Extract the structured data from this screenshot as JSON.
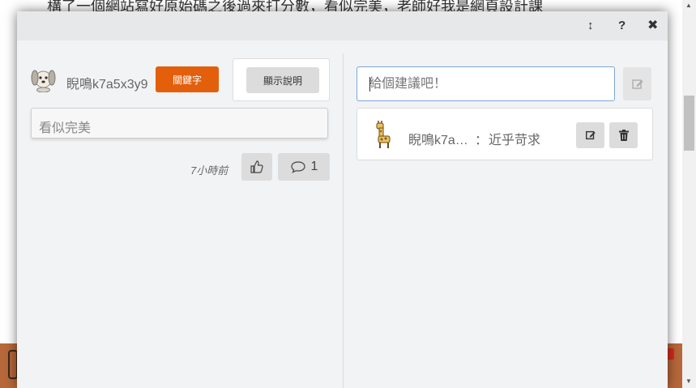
{
  "background": {
    "text": "構了一個網站寫好原始碼之後過來打分數，看似完美，老師好我是網頁設計課"
  },
  "modal": {
    "toolbar": {
      "resize_icon": "↕",
      "help_icon": "?",
      "close_icon": "✖"
    },
    "left": {
      "username": "睨鳴k7a5x3y9",
      "keyword_button": "關鍵字",
      "description_button": "顯示說明",
      "answer": "看似完美",
      "time": "7小時前",
      "comment_count": "1"
    },
    "right": {
      "suggest_placeholder": "給個建議吧！",
      "comment": {
        "user": "睨鳴k7a…",
        "separator": "：",
        "text": "近乎苛求"
      }
    }
  },
  "colors": {
    "accent": "#e35f0c",
    "input_border": "#7aa7d8"
  }
}
